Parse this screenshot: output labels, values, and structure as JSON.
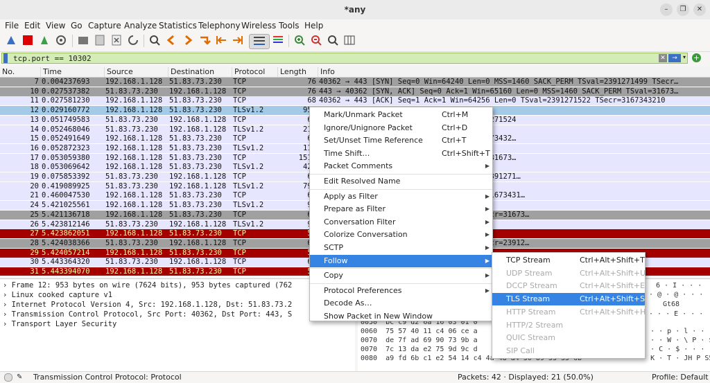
{
  "window": {
    "title": "*any"
  },
  "menubar": [
    "File",
    "Edit",
    "View",
    "Go",
    "Capture",
    "Analyze",
    "Statistics",
    "Telephony",
    "Wireless",
    "Tools",
    "Help"
  ],
  "filter": {
    "value": "tcp.port == 10302"
  },
  "columns": [
    "No.",
    "Time",
    "Source",
    "Destination",
    "Protocol",
    "Length",
    "Info"
  ],
  "packets": [
    {
      "no": "7",
      "time": "0.004237693",
      "src": "192.168.1.128",
      "dst": "51.83.73.230",
      "proto": "TCP",
      "len": "76",
      "info": "40362 → 443 [SYN] Seq=0 Win=64240 Len=0 MSS=1460 SACK_PERM TSval=2391271499 TSecr…",
      "style": "gray"
    },
    {
      "no": "10",
      "time": "0.027537382",
      "src": "51.83.73.230",
      "dst": "192.168.1.128",
      "proto": "TCP",
      "len": "76",
      "info": "443 → 40362 [SYN, ACK] Seq=0 Ack=1 Win=65160 Len=0 MSS=1460 SACK_PERM TSval=31673…",
      "style": "gray"
    },
    {
      "no": "11",
      "time": "0.027581230",
      "src": "192.168.1.128",
      "dst": "51.83.73.230",
      "proto": "TCP",
      "len": "68",
      "info": "40362 → 443 [ACK] Seq=1 Ack=1 Win=64256 Len=0 TSval=2391271522 TSecr=3167343210",
      "style": "lav"
    },
    {
      "no": "12",
      "time": "0.029160772",
      "src": "192.168.1.128",
      "dst": "51.83.73.230",
      "proto": "TLSv1.2",
      "len": "953",
      "info": "",
      "style": "sel"
    },
    {
      "no": "13",
      "time": "0.051749583",
      "src": "51.83.73.230",
      "dst": "192.168.1.128",
      "proto": "TCP",
      "len": "68",
      "info": "64384 Len=0 TSval=3167343235 TSecr=2391271524",
      "style": "lav"
    },
    {
      "no": "14",
      "time": "0.052468046",
      "src": "51.83.73.230",
      "dst": "192.168.1.128",
      "proto": "TLSv1.2",
      "len": "216",
      "info": "crypted Handshake Message",
      "style": "lav"
    },
    {
      "no": "15",
      "time": "0.052491649",
      "src": "192.168.1.128",
      "dst": "51.83.73.230",
      "proto": "TCP",
      "len": "68",
      "info": "=64128 Len=0 TSval=2391271547 TSecr=31673432…",
      "style": "lav"
    },
    {
      "no": "16",
      "time": "0.052872323",
      "src": "192.168.1.128",
      "dst": "51.83.73.230",
      "proto": "TLSv1.2",
      "len": "119",
      "info": "ake Message",
      "style": "lav"
    },
    {
      "no": "17",
      "time": "0.053059380",
      "src": "192.168.1.128",
      "dst": "51.83.73.230",
      "proto": "TCP",
      "len": "1516",
      "info": "=64128 Len=1448 TSval=2391271548 TSecr=31673…",
      "style": "lav"
    },
    {
      "no": "18",
      "time": "0.053069642",
      "src": "192.168.1.128",
      "dst": "51.83.73.230",
      "proto": "TLSv1.2",
      "len": "420",
      "info": "",
      "style": "lav"
    },
    {
      "no": "19",
      "time": "0.075853392",
      "src": "51.83.73.230",
      "dst": "192.168.1.128",
      "proto": "TCP",
      "len": "68",
      "info": "in=64128 Len=0 TSval=3167343259 TSecr=2391271…",
      "style": "lav"
    },
    {
      "no": "20",
      "time": "0.419089925",
      "src": "51.83.73.230",
      "dst": "192.168.1.128",
      "proto": "TLSv1.2",
      "len": "793",
      "info": "",
      "style": "lav"
    },
    {
      "no": "21",
      "time": "0.460047530",
      "src": "192.168.1.128",
      "dst": "51.83.73.230",
      "proto": "TCP",
      "len": "68",
      "info": "in=64128 Len=0 TSval=2391271955 TSecr=31673431…",
      "style": "lav"
    },
    {
      "no": "24",
      "time": "5.421025561",
      "src": "192.168.1.128",
      "dst": "51.83.73.230",
      "proto": "TLSv1.2",
      "len": "99",
      "info": "",
      "style": "lav"
    },
    {
      "no": "25",
      "time": "5.421136718",
      "src": "192.168.1.128",
      "dst": "51.83.73.230",
      "proto": "TCP",
      "len": "68",
      "info": "87 Win=64128 Len=0 TSval=2391276916 TSecr=31673…",
      "style": "gray"
    },
    {
      "no": "26",
      "time": "5.423812146",
      "src": "51.83.73.230",
      "dst": "192.168.1.128",
      "proto": "TLSv1.2",
      "len": "99",
      "info": "",
      "style": "lav"
    },
    {
      "no": "27",
      "time": "5.423862051",
      "src": "192.168.1.128",
      "dst": "51.83.73.230",
      "proto": "TCP",
      "len": "56",
      "info": "0",
      "style": "red"
    },
    {
      "no": "28",
      "time": "5.424038366",
      "src": "51.83.73.230",
      "dst": "192.168.1.128",
      "proto": "TCP",
      "len": "68",
      "info": "45 Win=64128 Len=0 TSval=3167348607 TSecr=23912…",
      "style": "gray"
    },
    {
      "no": "29",
      "time": "5.424057214",
      "src": "192.168.1.128",
      "dst": "51.83.73.230",
      "proto": "TCP",
      "len": "56",
      "info": "0",
      "style": "red"
    },
    {
      "no": "30",
      "time": "5.443364320",
      "src": "51.83.73.230",
      "dst": "192.168.1.128",
      "proto": "TCP",
      "len": "68",
      "info": "in=64128 Len=0 TSval=3167348627 TSecr=2391276…",
      "style": "lav"
    },
    {
      "no": "31",
      "time": "5.443394070",
      "src": "192.168.1.128",
      "dst": "51.83.73.230",
      "proto": "TCP",
      "len": "56",
      "info": "0",
      "style": "red"
    }
  ],
  "details": [
    "Frame 12: 953 bytes on wire (7624 bits), 953 bytes captured (762",
    "Linux cooked capture v1",
    "Internet Protocol Version 4, Src: 192.168.1.128, Dst: 51.83.73.2",
    "Transmission Control Protocol, Src Port: 40362, Dst Port: 443, S",
    "Transport Layer Security"
  ],
  "bytes": [
    {
      "off": "0050",
      "hex": "bc c9 d2 6a 16 03 01 0",
      "ascii": ""
    },
    {
      "off": "0060",
      "hex": "75 57 40 11 c4 06 ce a",
      "ascii": "· · · · p · l · · ·"
    },
    {
      "off": "0070",
      "hex": "de 7f ad 69 90 73 9b a",
      "ascii": "· · · · W · \\ P · $"
    },
    {
      "off": "0070",
      "hex": "7c 13 da e2 75 9d 9c d",
      "ascii": "· · · C · $ · · · ·"
    },
    {
      "off": "0080",
      "hex": "a9 fd 6b c1 e2 54 14 c4  4a 48 a4 50 89 53 35 6b",
      "ascii": "· · K · T · JH P S5"
    }
  ],
  "bytes_right": [
    "6 · I · · ·",
    "· @ · @ · · ·",
    "Gt68",
    "· · · E · · ·"
  ],
  "status": {
    "left": "Transmission Control Protocol: Protocol",
    "packets": "Packets: 42 · Displayed: 21 (50.0%)",
    "profile": "Profile: Default"
  },
  "context_menu": {
    "items": [
      {
        "label": "Mark/Unmark Packet",
        "shortcut": "Ctrl+M"
      },
      {
        "label": "Ignore/Unignore Packet",
        "shortcut": "Ctrl+D"
      },
      {
        "label": "Set/Unset Time Reference",
        "shortcut": "Ctrl+T"
      },
      {
        "label": "Time Shift…",
        "shortcut": "Ctrl+Shift+T"
      },
      {
        "label": "Packet Comments",
        "shortcut": "",
        "submenu": true
      },
      {
        "label": "Edit Resolved Name",
        "shortcut": "",
        "sep_before": true
      },
      {
        "label": "Apply as Filter",
        "shortcut": "",
        "submenu": true,
        "sep_before": true
      },
      {
        "label": "Prepare as Filter",
        "shortcut": "",
        "submenu": true
      },
      {
        "label": "Conversation Filter",
        "shortcut": "",
        "submenu": true
      },
      {
        "label": "Colorize Conversation",
        "shortcut": "",
        "submenu": true
      },
      {
        "label": "SCTP",
        "shortcut": "",
        "submenu": true
      },
      {
        "label": "Follow",
        "shortcut": "",
        "submenu": true,
        "highlight": true
      },
      {
        "label": "Copy",
        "shortcut": "",
        "submenu": true,
        "sep_before": true
      },
      {
        "label": "Protocol Preferences",
        "shortcut": "",
        "submenu": true,
        "sep_before": true
      },
      {
        "label": "Decode As…",
        "shortcut": ""
      },
      {
        "label": "Show Packet in New Window",
        "shortcut": ""
      }
    ]
  },
  "follow_menu": {
    "items": [
      {
        "label": "TCP Stream",
        "shortcut": "Ctrl+Alt+Shift+T"
      },
      {
        "label": "UDP Stream",
        "shortcut": "Ctrl+Alt+Shift+U",
        "disabled": true
      },
      {
        "label": "DCCP Stream",
        "shortcut": "Ctrl+Alt+Shift+E",
        "disabled": true
      },
      {
        "label": "TLS Stream",
        "shortcut": "Ctrl+Alt+Shift+S",
        "highlight": true
      },
      {
        "label": "HTTP Stream",
        "shortcut": "Ctrl+Alt+Shift+H",
        "disabled": true
      },
      {
        "label": "HTTP/2 Stream",
        "shortcut": "",
        "disabled": true
      },
      {
        "label": "QUIC Stream",
        "shortcut": "",
        "disabled": true
      },
      {
        "label": "SIP Call",
        "shortcut": "",
        "disabled": true
      }
    ]
  },
  "colors": {
    "gray_row": "#a0a0a0",
    "lav_row": "#e7e6ff",
    "sel_row": "#a3cbe8",
    "red_row": "#a40000",
    "red_text": "#fffc9c",
    "accent": "#3584e4"
  }
}
